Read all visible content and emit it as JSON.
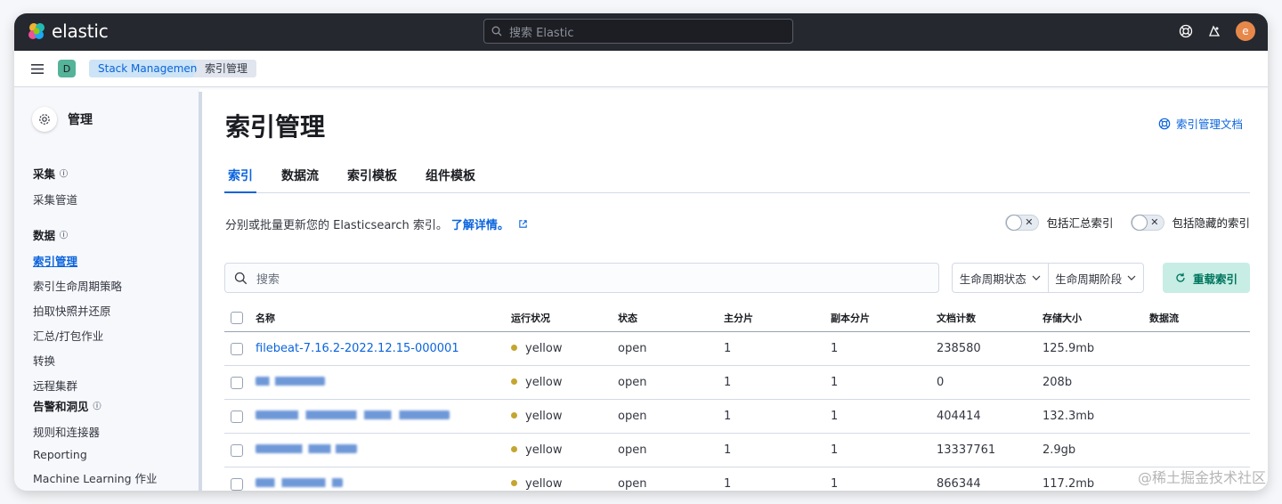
{
  "topbar": {
    "logo_text": "elastic",
    "search_placeholder": "搜索 Elastic",
    "avatar_letter": "e"
  },
  "breadcrumbs": {
    "space_letter": "D",
    "items": [
      "Stack Management",
      "索引管理"
    ]
  },
  "sidebar": {
    "title": "管理",
    "groups": [
      {
        "title": "采集",
        "items": [
          "采集管道"
        ]
      },
      {
        "title": "数据",
        "items": [
          "索引管理",
          "索引生命周期策略",
          "拍取快照并还原",
          "汇总/打包作业",
          "转换",
          "远程集群"
        ]
      },
      {
        "title": "告警和洞见",
        "items": [
          "规则和连接器",
          "Reporting",
          "Machine Learning 作业"
        ]
      }
    ]
  },
  "main": {
    "title": "索引管理",
    "docs_link": "索引管理文档",
    "tabs": [
      "索引",
      "数据流",
      "索引模板",
      "组件模板"
    ],
    "description": "分别或批量更新您的 Elasticsearch 索引。",
    "learn_more": "了解详情。",
    "toggle_rollup": "包括汇总索引",
    "toggle_hidden": "包括隐藏的索引",
    "search_placeholder": "搜索",
    "filter_lifecycle_status": "生命周期状态",
    "filter_lifecycle_phase": "生命周期阶段",
    "reload_button": "重载索引"
  },
  "table": {
    "headers": [
      "名称",
      "运行状况",
      "状态",
      "主分片",
      "副本分片",
      "文档计数",
      "存储大小",
      "数据流"
    ],
    "rows": [
      {
        "name": "filebeat-7.16.2-2022.12.15-000001",
        "health": "yellow",
        "status": "open",
        "primary": "1",
        "replica": "1",
        "docs": "238580",
        "size": "125.9mb"
      },
      {
        "name": "",
        "health": "yellow",
        "status": "open",
        "primary": "1",
        "replica": "1",
        "docs": "0",
        "size": "208b"
      },
      {
        "name": "",
        "health": "yellow",
        "status": "open",
        "primary": "1",
        "replica": "1",
        "docs": "404414",
        "size": "132.3mb"
      },
      {
        "name": "",
        "health": "yellow",
        "status": "open",
        "primary": "1",
        "replica": "1",
        "docs": "13337761",
        "size": "2.9gb"
      },
      {
        "name": "",
        "health": "yellow",
        "status": "open",
        "primary": "1",
        "replica": "1",
        "docs": "866344",
        "size": "117.2mb"
      }
    ]
  },
  "watermark": "@稀土掘金技术社区",
  "colors": {
    "accent": "#0b64dd",
    "health_yellow": "#c5a531",
    "reload_bg": "#c7ede5"
  }
}
